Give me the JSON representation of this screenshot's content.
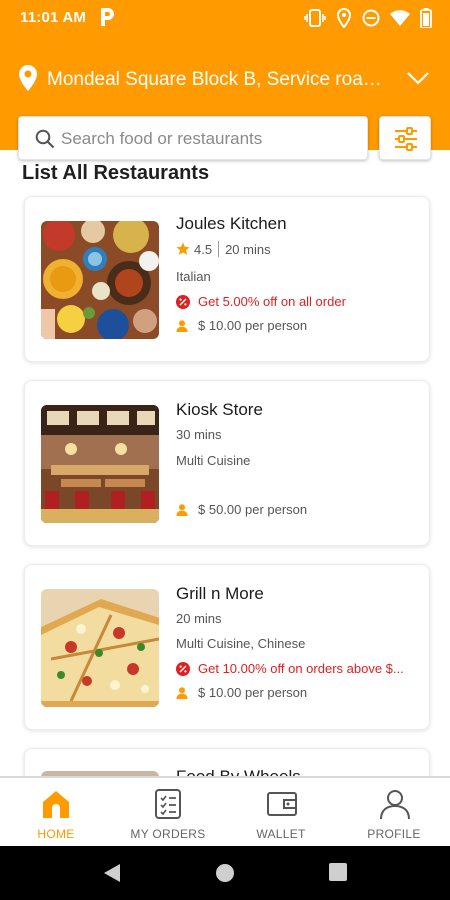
{
  "status_bar": {
    "time": "11:01 AM",
    "icons": [
      "parking-icon",
      "vibrate-icon",
      "location-icon",
      "dnd-icon",
      "wifi-icon",
      "battery-icon"
    ]
  },
  "header": {
    "location": "Mondeal Square Block B, Service road -...",
    "icons": [
      "location-pin-icon",
      "chevron-down-icon"
    ]
  },
  "search": {
    "placeholder": "Search food or restaurants",
    "value": ""
  },
  "filter": {
    "icon": "filter-sliders-icon"
  },
  "section": {
    "title": "List All Restaurants"
  },
  "restaurants": [
    {
      "name": "Joules Kitchen",
      "rating": "4.5",
      "time": "20 mins",
      "cuisine": "Italian",
      "offer": "Get 5.00% off on all order",
      "price": "$ 10.00 per person"
    },
    {
      "name": "Kiosk Store",
      "time": "30 mins",
      "cuisine": "Multi Cuisine",
      "offer": "",
      "price": "$ 50.00 per person"
    },
    {
      "name": "Grill n More",
      "time": "20 mins",
      "cuisine": "Multi Cuisine, Chinese",
      "offer": "Get 10.00% off on orders above $...",
      "price": "$ 10.00 per person"
    },
    {
      "name": "Food By Wheels"
    }
  ],
  "bottom_nav": {
    "items": [
      {
        "label": "HOME",
        "icon": "home-icon",
        "active": true
      },
      {
        "label": "MY ORDERS",
        "icon": "orders-icon",
        "active": false
      },
      {
        "label": "WALLET",
        "icon": "wallet-icon",
        "active": false
      },
      {
        "label": "PROFILE",
        "icon": "profile-icon",
        "active": false
      }
    ]
  },
  "colors": {
    "brand": "#ff9a00",
    "offer": "#e02020",
    "star": "#f4a000"
  }
}
